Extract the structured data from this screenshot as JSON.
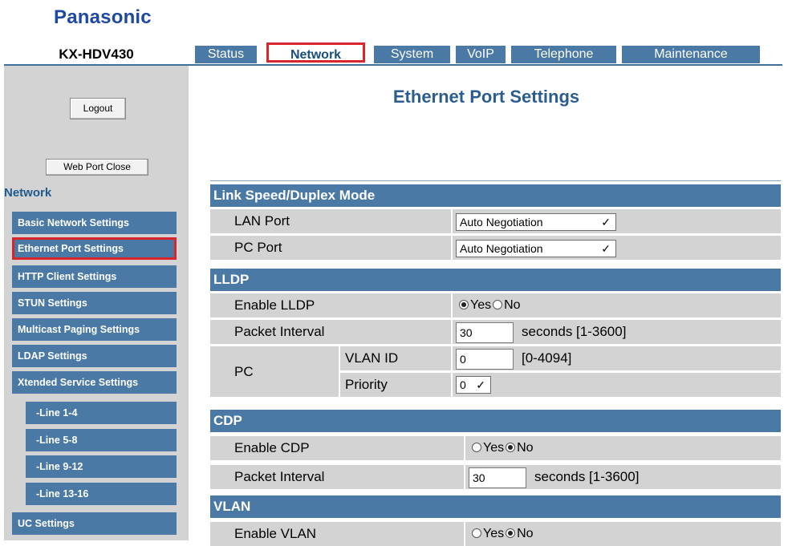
{
  "brand": "Panasonic",
  "model": "KX-HDV430",
  "tabs": [
    "Status",
    "Network",
    "System",
    "VoIP",
    "Telephone",
    "Maintenance"
  ],
  "active_tab": "Network",
  "buttons": {
    "logout": "Logout",
    "web_port_close": "Web Port Close"
  },
  "sidebar": {
    "heading": "Network",
    "items": [
      "Basic Network Settings",
      "Ethernet Port Settings",
      "HTTP Client Settings",
      "STUN Settings",
      "Multicast Paging Settings",
      "LDAP Settings",
      "Xtended Service Settings"
    ],
    "subitems": [
      "-Line 1-4",
      "-Line 5-8",
      "-Line 9-12",
      "-Line 13-16"
    ],
    "after": [
      "UC Settings"
    ],
    "selected": "Ethernet Port Settings"
  },
  "page_title": "Ethernet Port Settings",
  "sections": {
    "link_speed": {
      "title": "Link Speed/Duplex Mode",
      "lan_label": "LAN Port",
      "lan_value": "Auto Negotiation",
      "pc_label": "PC Port",
      "pc_value": "Auto Negotiation"
    },
    "lldp": {
      "title": "LLDP",
      "enable_label": "Enable LLDP",
      "enable_value": "Yes",
      "interval_label": "Packet Interval",
      "interval_value": "30",
      "interval_hint": "seconds [1-3600]",
      "pc_label": "PC",
      "vlan_id_label": "VLAN ID",
      "vlan_id_value": "0",
      "vlan_id_hint": "[0-4094]",
      "priority_label": "Priority",
      "priority_value": "0"
    },
    "cdp": {
      "title": "CDP",
      "enable_label": "Enable CDP",
      "enable_value": "No",
      "interval_label": "Packet Interval",
      "interval_value": "30",
      "interval_hint": "seconds [1-3600]"
    },
    "vlan": {
      "title": "VLAN",
      "enable_label": "Enable VLAN",
      "enable_value": "No"
    }
  },
  "radio_labels": {
    "yes": "Yes",
    "no": "No"
  },
  "colors": {
    "accent": "#4a79a6",
    "brand": "#1d4aa0",
    "highlight": "#d9262c",
    "panel": "#d3d3d3"
  }
}
